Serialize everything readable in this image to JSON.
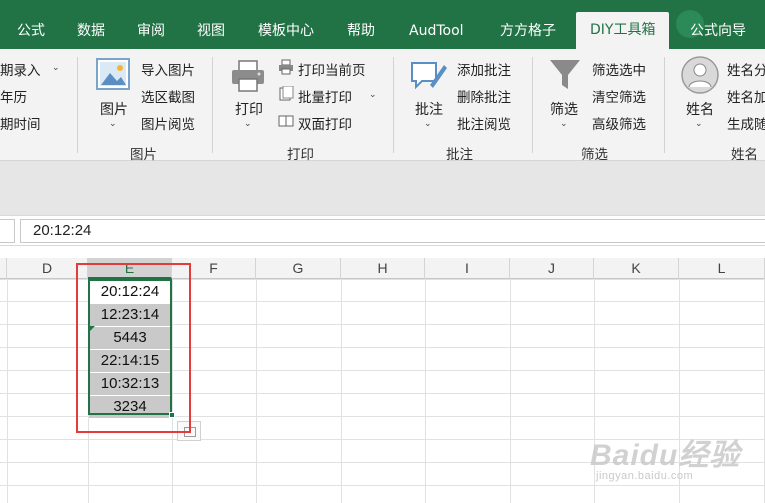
{
  "tabs": [
    {
      "label": "公式",
      "active": false
    },
    {
      "label": "数据",
      "active": false
    },
    {
      "label": "审阅",
      "active": false
    },
    {
      "label": "视图",
      "active": false
    },
    {
      "label": "模板中心",
      "active": false
    },
    {
      "label": "帮助",
      "active": false
    },
    {
      "label": "AudTool",
      "active": false
    },
    {
      "label": "方方格子",
      "active": false
    },
    {
      "label": "DIY工具箱",
      "active": true
    },
    {
      "label": "公式向导",
      "active": false
    }
  ],
  "ribbon": {
    "date_group": {
      "items": [
        "期录入",
        "年历",
        "期时间"
      ]
    },
    "picture_group": {
      "big_label": "图片",
      "items": [
        "导入图片",
        "选区截图",
        "图片阅览"
      ],
      "group_label": "图片"
    },
    "print_group": {
      "big_label": "打印",
      "items": [
        "打印当前页",
        "批量打印",
        "双面打印"
      ],
      "group_label": "打印"
    },
    "comment_group": {
      "big_label": "批注",
      "items": [
        "添加批注",
        "删除批注",
        "批注阅览"
      ],
      "group_label": "批注"
    },
    "filter_group": {
      "big_label": "筛选",
      "items": [
        "筛选选中",
        "清空筛选",
        "高级筛选"
      ],
      "group_label": "筛选"
    },
    "name_group": {
      "big_label": "姓名",
      "items": [
        "姓名分",
        "姓名加",
        "生成随"
      ],
      "group_label": "姓名"
    }
  },
  "formula_bar": {
    "value": "20:12:24"
  },
  "columns": [
    "D",
    "E",
    "F",
    "G",
    "H",
    "I",
    "J",
    "K",
    "L"
  ],
  "selected_column": "E",
  "cells": [
    "20:12:24",
    "12:23:14",
    "5443",
    "22:14:15",
    "10:32:13",
    "3234"
  ],
  "watermark": {
    "brand": "Baidu经验",
    "url": "jingyan.baidu.com"
  },
  "colors": {
    "accent": "#217346",
    "highlight": "#e53b3b"
  }
}
